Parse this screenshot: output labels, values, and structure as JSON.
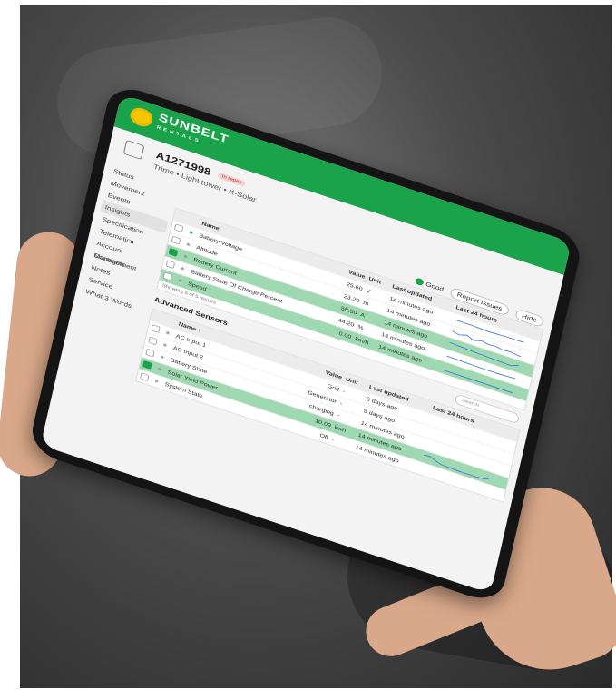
{
  "app": {
    "brand": "SUNBELT",
    "brand_sub": "RENTALS"
  },
  "asset": {
    "id": "A1271998",
    "badge": "In repair",
    "description": "Trime • Light tower • X-Solar"
  },
  "actions": {
    "good": "Good",
    "report": "Report Issues",
    "hide": "Hide"
  },
  "sidebar": {
    "items": [
      {
        "label": "Status"
      },
      {
        "label": "Movement"
      },
      {
        "label": "Events"
      },
      {
        "label": "Insights",
        "active": true
      },
      {
        "label": "Specification"
      },
      {
        "label": "Telematics"
      },
      {
        "label": "Account Management"
      },
      {
        "label": "Contracts"
      },
      {
        "label": "Notes"
      },
      {
        "label": "Service"
      },
      {
        "label": "What 3 Words"
      }
    ]
  },
  "sensors": {
    "columns": {
      "name": "Name",
      "value": "Value",
      "unit": "Unit",
      "last_updated": "Last updated",
      "trend": "Last 24 hours"
    },
    "rows": [
      {
        "name": "Battery Voltage",
        "value": "25.60",
        "unit": "V",
        "updated": "14 minutes ago"
      },
      {
        "name": "Altitude",
        "value": "23.20",
        "unit": "m",
        "updated": "14 minutes ago"
      },
      {
        "name": "Battery Current",
        "value": "58.50",
        "unit": "A",
        "updated": "14 minutes ago"
      },
      {
        "name": "Battery State Of Charge Percent",
        "value": "44.20",
        "unit": "%",
        "updated": "14 minutes ago"
      },
      {
        "name": "Speed",
        "value": "0.00",
        "unit": "km/h",
        "updated": "14 minutes ago"
      }
    ],
    "footer": "Showing 5 of 5 results"
  },
  "advanced": {
    "title": "Advanced Sensors",
    "search_placeholder": "Search",
    "columns": {
      "name": "Name ↑",
      "value": "Value",
      "unit": "Unit",
      "last_updated": "Last updated",
      "trend": "Last 24 hours"
    },
    "rows": [
      {
        "name": "AC Input 1",
        "value": "Grid",
        "unit": "-",
        "updated": "5 days ago"
      },
      {
        "name": "AC Input 2",
        "value": "Generator",
        "unit": "-",
        "updated": "5 days ago"
      },
      {
        "name": "Battery State",
        "value": "charging",
        "unit": "-",
        "updated": "14 minutes ago"
      },
      {
        "name": "Solar Yield Power",
        "value": "10.09",
        "unit": "kwh",
        "updated": "14 minutes ago"
      },
      {
        "name": "System State",
        "value": "Off",
        "unit": "-",
        "updated": "14 minutes ago"
      }
    ]
  },
  "colors": {
    "brand_green": "#1aa34a",
    "highlight": "#9ed9b1",
    "logo_sun": "#f7c600"
  }
}
